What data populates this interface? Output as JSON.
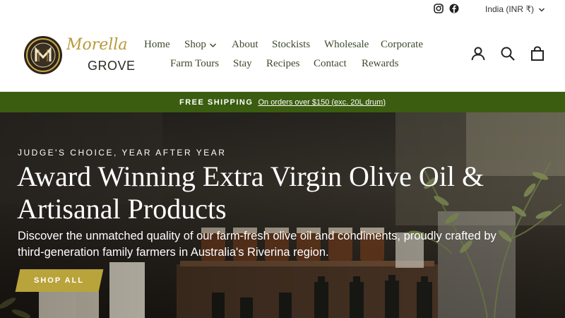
{
  "utility": {
    "social": [
      "instagram-icon",
      "facebook-icon"
    ],
    "currency": "India (INR ₹)"
  },
  "brand": {
    "name_line1": "Morella",
    "name_line2": "GROVE",
    "monogram": "M"
  },
  "nav": {
    "row1": [
      {
        "label": "Home"
      },
      {
        "label": "Shop",
        "dropdown": true
      },
      {
        "label": "About"
      },
      {
        "label": "Stockists"
      },
      {
        "label": "Wholesale"
      },
      {
        "label": "Corporate"
      }
    ],
    "row2": [
      {
        "label": "Farm Tours"
      },
      {
        "label": "Stay"
      },
      {
        "label": "Recipes"
      },
      {
        "label": "Contact"
      },
      {
        "label": "Rewards"
      }
    ]
  },
  "header_icons": [
    "account-icon",
    "search-icon",
    "cart-icon"
  ],
  "announcement": {
    "strong": "FREE SHIPPING",
    "link": "On orders over $150 (exc. 20L drum)"
  },
  "hero": {
    "eyebrow": "JUDGE'S CHOICE, YEAR AFTER YEAR",
    "title": "Award Winning Extra Virgin Olive Oil & Artisanal Products",
    "subtitle": "Discover the unmatched quality of our farm-fresh olive oil and condiments, proudly crafted by third-generation family farmers in Australia's Riverina region.",
    "cta": "SHOP ALL"
  },
  "colors": {
    "brand_green": "#3b5d10",
    "nav_text": "#3f4a2b",
    "gold": "#b9a33b"
  }
}
